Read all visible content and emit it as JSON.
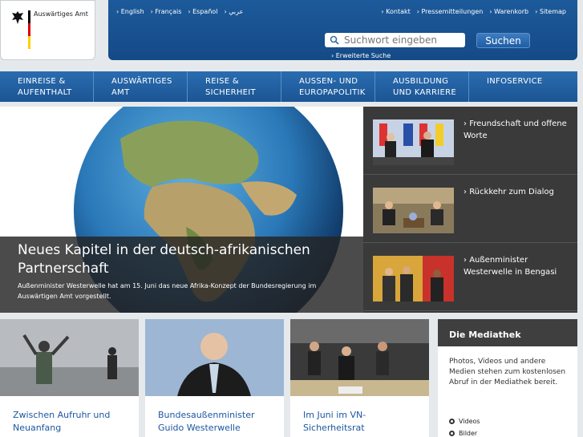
{
  "logo": {
    "text": "Auswärtiges Amt",
    "flag_colors": [
      "#000000",
      "#dd0000",
      "#ffce00"
    ]
  },
  "header": {
    "languages": [
      "English",
      "Français",
      "Español",
      "عربي"
    ],
    "utility_links": [
      "Kontakt",
      "Pressemitteilungen",
      "Warenkorb",
      "Sitemap"
    ],
    "search": {
      "placeholder": "Suchwort eingeben",
      "button": "Suchen",
      "advanced": "Erweiterte Suche"
    }
  },
  "nav": [
    {
      "line1": "EINREISE &",
      "line2": "AUFENTHALT"
    },
    {
      "line1": "AUSWÄRTIGES",
      "line2": "AMT"
    },
    {
      "line1": "REISE &",
      "line2": "SICHERHEIT"
    },
    {
      "line1": "AUSSEN- UND",
      "line2": "EUROPAPOLITIK"
    },
    {
      "line1": "AUSBILDUNG",
      "line2": "UND KARRIERE"
    },
    {
      "line1": "INFOSERVICE",
      "line2": ""
    }
  ],
  "hero": {
    "title": "Neues Kapitel in der deutsch-afrikanischen Partnerschaft",
    "text": "Außenminister Westerwelle hat am 15. Juni das neue Afrika-Konzept der Bundesregierung im Auswärtigen Amt vorgestellt."
  },
  "side_news": [
    {
      "title": "Freundschaft und offene Worte"
    },
    {
      "title": "Rückkehr zum Dialog"
    },
    {
      "title": "Außenminister Westerwelle in Bengasi"
    }
  ],
  "teasers": [
    {
      "title": "Zwischen Aufruhr und Neuanfang"
    },
    {
      "title": "Bundesaußenminister Guido Westerwelle"
    },
    {
      "title": "Im Juni im VN-Sicherheitsrat"
    }
  ],
  "mediathek": {
    "heading": "Die Mediathek",
    "text": "Photos, Videos und andere Medien stehen zum kostenlosen Abruf in der Mediathek bereit.",
    "links": [
      "Videos",
      "Bilder"
    ]
  },
  "colors": {
    "header_blue": "#1d5a9b",
    "nav_blue": "#2a6cb0",
    "link_blue": "#1b57a0",
    "dark_panel": "#3a3a3a"
  }
}
